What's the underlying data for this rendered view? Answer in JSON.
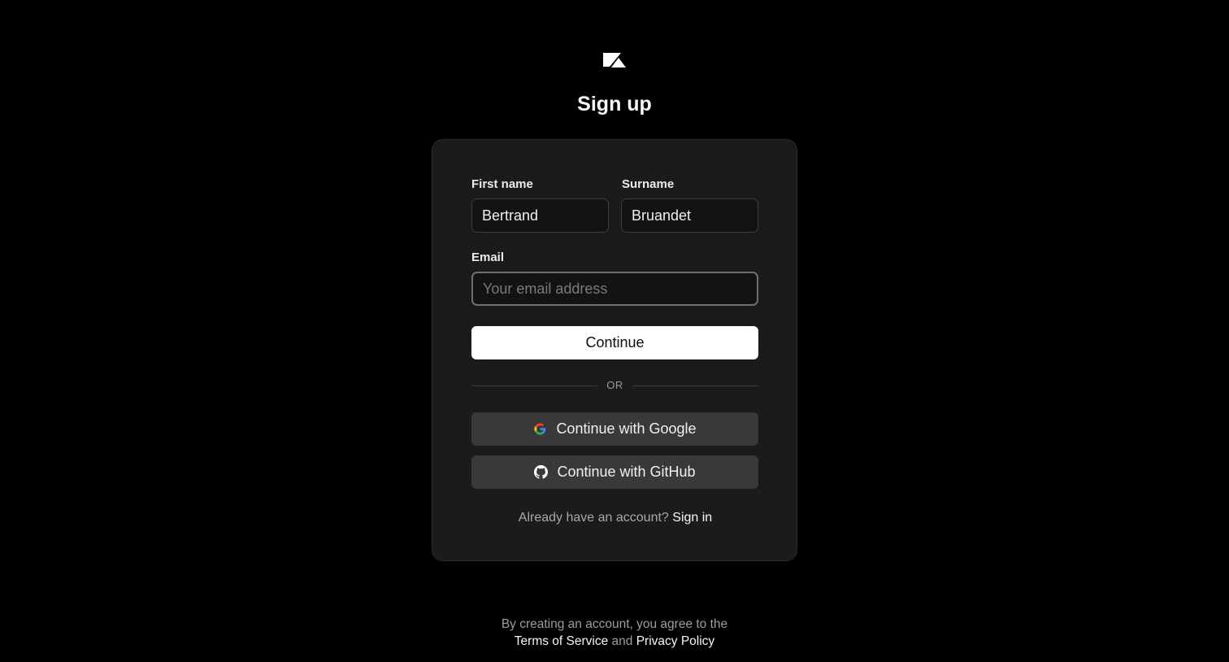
{
  "header": {
    "logo_icon": "zed-logo-icon",
    "title": "Sign up"
  },
  "form": {
    "first_name": {
      "label": "First name",
      "value": "Bertrand"
    },
    "surname": {
      "label": "Surname",
      "value": "Bruandet"
    },
    "email": {
      "label": "Email",
      "value": "",
      "placeholder": "Your email address"
    },
    "continue_label": "Continue",
    "divider_text": "OR",
    "google_label": "Continue with Google",
    "github_label": "Continue with GitHub",
    "signin_prompt": "Already have an account?",
    "signin_link": "Sign in"
  },
  "footer": {
    "line1": "By creating an account, you agree to the",
    "terms_link": "Terms of Service",
    "and_text": "and",
    "privacy_link": "Privacy Policy"
  },
  "colors": {
    "background": "#000000",
    "card": "#1b1b1b",
    "primary_button": "#ffffff",
    "social_button": "#393939"
  }
}
